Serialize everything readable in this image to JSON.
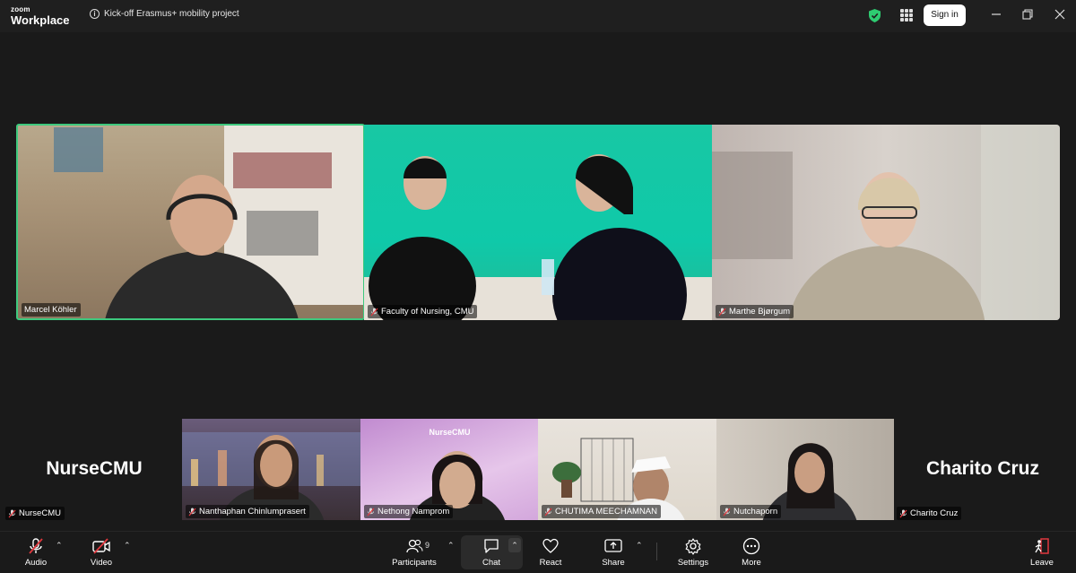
{
  "app": {
    "brand_small": "zoom",
    "brand_large": "Workplace"
  },
  "meeting": {
    "title": "Kick-off Erasmus+ mobility project"
  },
  "titlebar": {
    "signin_label": "Sign in"
  },
  "top_tiles": [
    {
      "name": "Marcel Köhler",
      "active_speaker": true
    },
    {
      "name": "Faculty of Nursing, CMU"
    },
    {
      "name": "Marthe Bjørgum"
    }
  ],
  "bottom_tiles": [
    {
      "name": "Nanthaphan Chinlumprasert"
    },
    {
      "name": "Nethong Namprom",
      "watermark": "NurseCMU"
    },
    {
      "name": "CHUTIMA MEECHAMNAN"
    },
    {
      "name": "Nutchaporn"
    }
  ],
  "side_avatars": {
    "left": {
      "display": "NurseCMU",
      "tag": "NurseCMU"
    },
    "right": {
      "display": "Charito Cruz",
      "tag": "Charito Cruz"
    }
  },
  "toolbar": {
    "audio": "Audio",
    "video": "Video",
    "participants": "Participants",
    "participant_count": "9",
    "chat": "Chat",
    "react": "React",
    "share": "Share",
    "settings": "Settings",
    "more": "More",
    "leave": "Leave"
  },
  "colors": {
    "active_border": "#3ec97e",
    "muted_red": "#e0383e",
    "secure_green": "#2ecc71"
  }
}
